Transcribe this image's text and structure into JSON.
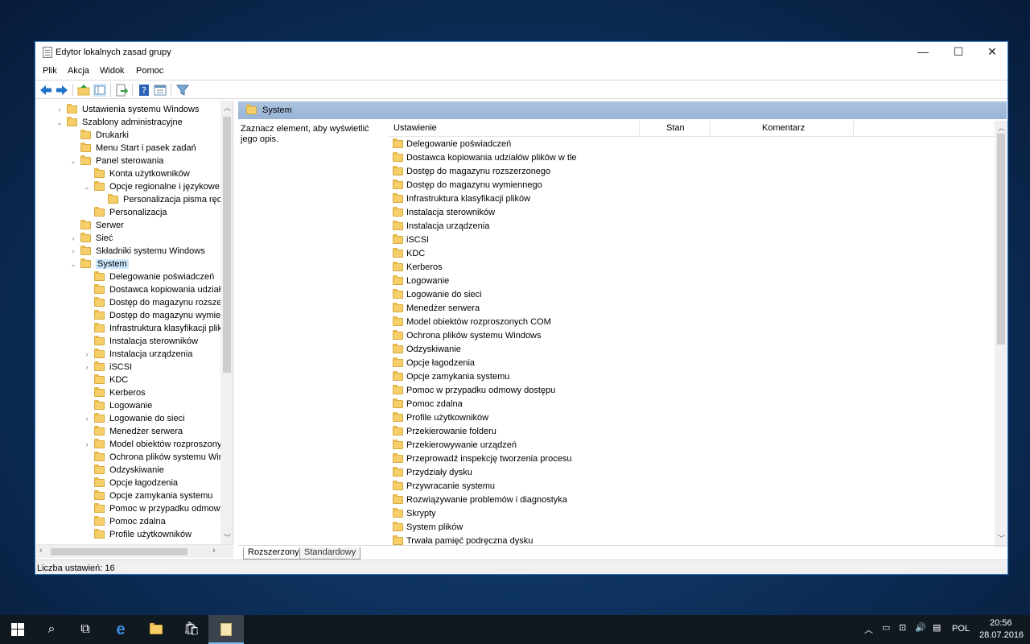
{
  "window": {
    "title": "Edytor lokalnych zasad grupy",
    "minimize": "—",
    "maximize": "☐",
    "close": "✕"
  },
  "menu": [
    "Plik",
    "Akcja",
    "Widok",
    "Pomoc"
  ],
  "toolbar": {
    "icons": [
      "back-arrow-icon",
      "forward-arrow-icon",
      "up-folder-icon",
      "show-hide-tree-icon",
      "export-list-icon",
      "help-icon",
      "properties-icon",
      "filter-icon"
    ]
  },
  "tree": [
    {
      "label": "Ustawienia systemu Windows",
      "level": 1,
      "chev": "›"
    },
    {
      "label": "Szablony administracyjne",
      "level": 1,
      "chev": "⌄"
    },
    {
      "label": "Drukarki",
      "level": 2,
      "chev": ""
    },
    {
      "label": "Menu Start i pasek zadań",
      "level": 2,
      "chev": ""
    },
    {
      "label": "Panel sterowania",
      "level": 2,
      "chev": "⌄"
    },
    {
      "label": "Konta użytkowników",
      "level": 3,
      "chev": ""
    },
    {
      "label": "Opcje regionalne i językowe",
      "level": 3,
      "chev": "⌄"
    },
    {
      "label": "Personalizacja pisma ręcz",
      "level": 4,
      "chev": ""
    },
    {
      "label": "Personalizacja",
      "level": 3,
      "chev": ""
    },
    {
      "label": "Serwer",
      "level": 2,
      "chev": ""
    },
    {
      "label": "Sieć",
      "level": 2,
      "chev": "›"
    },
    {
      "label": "Składniki systemu Windows",
      "level": 2,
      "chev": "›"
    },
    {
      "label": "System",
      "level": 2,
      "chev": "⌄",
      "selected": true
    },
    {
      "label": "Delegowanie poświadczeń",
      "level": 3,
      "chev": ""
    },
    {
      "label": "Dostawca kopiowania udziałó",
      "level": 3,
      "chev": ""
    },
    {
      "label": "Dostęp do magazynu rozszerz",
      "level": 3,
      "chev": ""
    },
    {
      "label": "Dostęp do magazynu wymien",
      "level": 3,
      "chev": ""
    },
    {
      "label": "Infrastruktura klasyfikacji plikó",
      "level": 3,
      "chev": ""
    },
    {
      "label": "Instalacja sterowników",
      "level": 3,
      "chev": ""
    },
    {
      "label": "Instalacja urządzenia",
      "level": 3,
      "chev": "›"
    },
    {
      "label": "iSCSI",
      "level": 3,
      "chev": "›"
    },
    {
      "label": "KDC",
      "level": 3,
      "chev": ""
    },
    {
      "label": "Kerberos",
      "level": 3,
      "chev": ""
    },
    {
      "label": "Logowanie",
      "level": 3,
      "chev": ""
    },
    {
      "label": "Logowanie do sieci",
      "level": 3,
      "chev": "›"
    },
    {
      "label": "Menedżer serwera",
      "level": 3,
      "chev": ""
    },
    {
      "label": "Model obiektów rozproszonyc",
      "level": 3,
      "chev": "›"
    },
    {
      "label": "Ochrona plików systemu Wind",
      "level": 3,
      "chev": ""
    },
    {
      "label": "Odzyskiwanie",
      "level": 3,
      "chev": ""
    },
    {
      "label": "Opcje łagodzenia",
      "level": 3,
      "chev": ""
    },
    {
      "label": "Opcje zamykania systemu",
      "level": 3,
      "chev": ""
    },
    {
      "label": "Pomoc w przypadku odmowy",
      "level": 3,
      "chev": ""
    },
    {
      "label": "Pomoc zdalna",
      "level": 3,
      "chev": ""
    },
    {
      "label": "Profile użytkowników",
      "level": 3,
      "chev": ""
    }
  ],
  "right": {
    "header": "System",
    "description": "Zaznacz element, aby wyświetlić jego opis.",
    "columns": [
      "Ustawienie",
      "Stan",
      "Komentarz"
    ],
    "items": [
      "Delegowanie poświadczeń",
      "Dostawca kopiowania udziałów plików w tle",
      "Dostęp do magazynu rozszerzonego",
      "Dostęp do magazynu wymiennego",
      "Infrastruktura klasyfikacji plików",
      "Instalacja sterowników",
      "Instalacja urządzenia",
      "iSCSI",
      "KDC",
      "Kerberos",
      "Logowanie",
      "Logowanie do sieci",
      "Menedżer serwera",
      "Model obiektów rozproszonych COM",
      "Ochrona plików systemu Windows",
      "Odzyskiwanie",
      "Opcje łagodzenia",
      "Opcje zamykania systemu",
      "Pomoc w przypadku odmowy dostępu",
      "Pomoc zdalna",
      "Profile użytkowników",
      "Przekierowanie folderu",
      "Przekierowywanie urządzeń",
      "Przeprowadź inspekcję tworzenia procesu",
      "Przydziały dysku",
      "Przywracanie systemu",
      "Rozwiązywanie problemów i diagnostyka",
      "Skrypty",
      "System plików",
      "Trwała pamięć podręczna dysku"
    ]
  },
  "tabs": [
    "Rozszerzony",
    "Standardowy"
  ],
  "status": "Liczba ustawień: 16",
  "taskbar": {
    "lang": "POL",
    "time": "20:56",
    "date": "28.07.2016"
  }
}
